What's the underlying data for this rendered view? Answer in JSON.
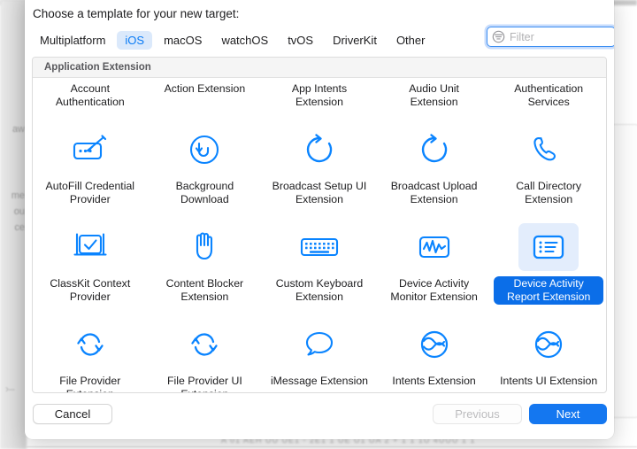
{
  "backdrop": {
    "left_text": [
      "aw",
      "me",
      "ou",
      "ce"
    ],
    "bottom_text": "A 01 AEH   UU  UE1 -  2E1 1 UE  U1 UA 2 +  1 1 1U   4UUU 1 1"
  },
  "dialog": {
    "title": "Choose a template for your new target:",
    "tabs": [
      {
        "label": "Multiplatform",
        "selected": false
      },
      {
        "label": "iOS",
        "selected": true
      },
      {
        "label": "macOS",
        "selected": false
      },
      {
        "label": "watchOS",
        "selected": false
      },
      {
        "label": "tvOS",
        "selected": false
      },
      {
        "label": "DriverKit",
        "selected": false
      },
      {
        "label": "Other",
        "selected": false
      }
    ],
    "filter": {
      "placeholder": "Filter",
      "value": "",
      "icon": "filter-icon",
      "focused": true
    },
    "section_header": "Application Extension",
    "rows": [
      {
        "cells": [
          {
            "label": "Account Authentication",
            "icon": "account-authentication-icon",
            "icon_visible": false,
            "selected": false
          },
          {
            "label": "Action Extension",
            "icon": "action-extension-icon",
            "icon_visible": false,
            "selected": false
          },
          {
            "label": "App Intents Extension",
            "icon": "app-intents-extension-icon",
            "icon_visible": false,
            "selected": false
          },
          {
            "label": "Audio Unit Extension",
            "icon": "audio-unit-extension-icon",
            "icon_visible": false,
            "selected": false
          },
          {
            "label": "Authentication Services",
            "icon": "authentication-services-icon",
            "icon_visible": false,
            "selected": false
          }
        ]
      },
      {
        "cells": [
          {
            "label": "AutoFill Credential Provider",
            "icon": "autofill-credential-icon",
            "icon_visible": true,
            "selected": false
          },
          {
            "label": "Background Download",
            "icon": "background-download-icon",
            "icon_visible": true,
            "selected": false
          },
          {
            "label": "Broadcast Setup UI Extension",
            "icon": "broadcast-setup-icon",
            "icon_visible": true,
            "selected": false
          },
          {
            "label": "Broadcast Upload Extension",
            "icon": "broadcast-upload-icon",
            "icon_visible": true,
            "selected": false
          },
          {
            "label": "Call Directory Extension",
            "icon": "call-directory-icon",
            "icon_visible": true,
            "selected": false
          }
        ]
      },
      {
        "cells": [
          {
            "label": "ClassKit Context Provider",
            "icon": "classkit-context-icon",
            "icon_visible": true,
            "selected": false
          },
          {
            "label": "Content Blocker Extension",
            "icon": "content-blocker-icon",
            "icon_visible": true,
            "selected": false
          },
          {
            "label": "Custom Keyboard Extension",
            "icon": "custom-keyboard-icon",
            "icon_visible": true,
            "selected": false
          },
          {
            "label": "Device Activity Monitor Extension",
            "icon": "device-activity-monitor-icon",
            "icon_visible": true,
            "selected": false
          },
          {
            "label": "Device Activity Report Extension",
            "icon": "device-activity-report-icon",
            "icon_visible": true,
            "selected": true
          }
        ]
      },
      {
        "cells": [
          {
            "label": "File Provider Extension",
            "icon": "file-provider-icon",
            "icon_visible": true,
            "selected": false
          },
          {
            "label": "File Provider UI Extension",
            "icon": "file-provider-ui-icon",
            "icon_visible": true,
            "selected": false
          },
          {
            "label": "iMessage Extension",
            "icon": "imessage-extension-icon",
            "icon_visible": true,
            "selected": false
          },
          {
            "label": "Intents Extension",
            "icon": "intents-extension-icon",
            "icon_visible": true,
            "selected": false
          },
          {
            "label": "Intents UI Extension",
            "icon": "intents-ui-extension-icon",
            "icon_visible": true,
            "selected": false
          }
        ]
      }
    ],
    "footer": {
      "cancel": "Cancel",
      "previous": "Previous",
      "next": "Next"
    }
  },
  "colors": {
    "accent_blue": "#0b6ee8",
    "button_blue": "#1477f0",
    "icon_blue": "#0a84ff",
    "tab_selected_bg": "#dbe9fb",
    "selected_icon_bg": "#e3edfc"
  }
}
